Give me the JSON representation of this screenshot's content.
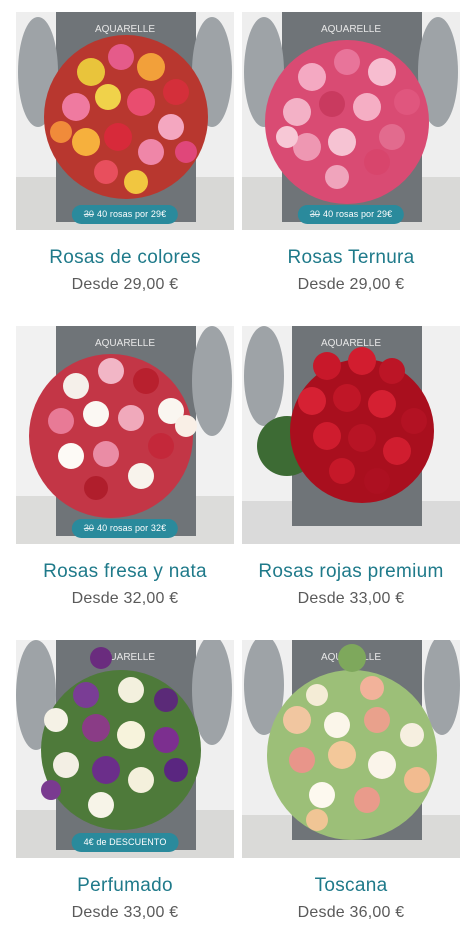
{
  "products": [
    {
      "name": "Rosas de colores",
      "price": "Desde 29,00 €",
      "badge_old": "30",
      "badge_text": "40 rosas por 29€"
    },
    {
      "name": "Rosas Ternura",
      "price": "Desde 29,00 €",
      "badge_old": "30",
      "badge_text": "40 rosas por 29€"
    },
    {
      "name": "Rosas fresa y nata",
      "price": "Desde 32,00 €",
      "badge_old": "30",
      "badge_text": "40 rosas por 32€"
    },
    {
      "name": "Rosas rojas premium",
      "price": "Desde 33,00 €",
      "badge_old": "",
      "badge_text": ""
    },
    {
      "name": "Perfumado",
      "price": "Desde 33,00 €",
      "badge_old": "",
      "badge_text": "4€ de DESCUENTO"
    },
    {
      "name": "Toscana",
      "price": "Desde 36,00 €",
      "badge_old": "",
      "badge_text": ""
    }
  ],
  "apron_brand": "AQUARELLE",
  "colors": {
    "accent": "#1f7a8a",
    "badge": "#2a8a9c",
    "price": "#5a5a5a"
  }
}
